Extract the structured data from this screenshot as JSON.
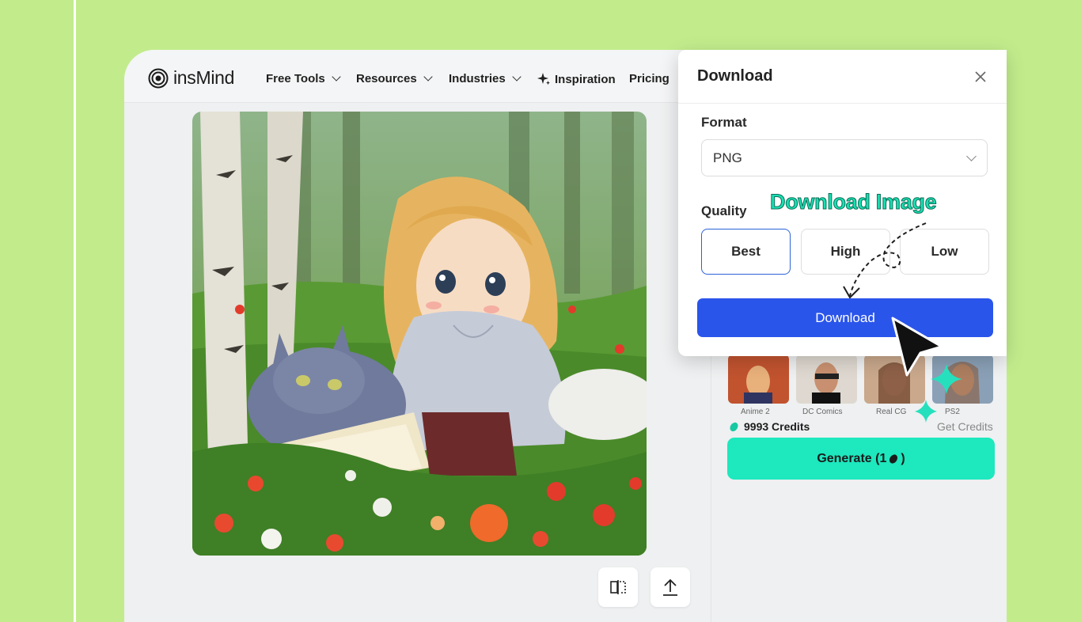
{
  "brand": {
    "name": "insMind",
    "logo_icon": "spiral-logo-icon"
  },
  "nav": {
    "items": [
      {
        "label": "Free Tools",
        "has_dropdown": true
      },
      {
        "label": "Resources",
        "has_dropdown": true
      },
      {
        "label": "Industries",
        "has_dropdown": true
      },
      {
        "label": "Inspiration",
        "icon": "sparkle-icon",
        "has_dropdown": false
      },
      {
        "label": "Pricing",
        "has_dropdown": false
      }
    ]
  },
  "canvas": {
    "image_icon": "generated-artwork",
    "tools": [
      {
        "icon": "compare-icon"
      },
      {
        "icon": "upload-icon"
      }
    ]
  },
  "panel": {
    "model_thumbnails": [
      {
        "label": "Anime 2"
      },
      {
        "label": "DC Comics"
      },
      {
        "label": "Real CG"
      },
      {
        "label": "PS2"
      }
    ],
    "credits": "9993 Credits",
    "get_credits": "Get Credits",
    "generate_label": "Generate (1",
    "generate_suffix": ")"
  },
  "dialog": {
    "title": "Download",
    "format_label": "Format",
    "format_value": "PNG",
    "quality_label": "Quality",
    "quality_options": [
      "Best",
      "High",
      "Low"
    ],
    "quality_selected": "Best",
    "download_label": "Download"
  },
  "annotation": {
    "callout": "Download Image"
  },
  "colors": {
    "background": "#c2ec8c",
    "primary": "#2a55eb",
    "accent": "#1de8be",
    "callout": "#18dfb2"
  }
}
